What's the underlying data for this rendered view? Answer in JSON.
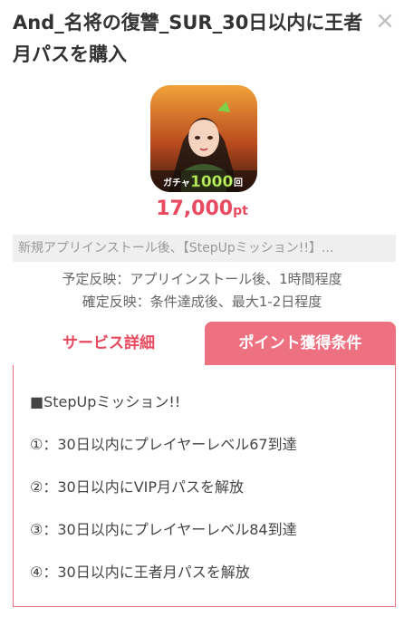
{
  "header": {
    "title": "And_名将の復讐_SUR_30日以内に王者月パスを購入",
    "close_label": "×"
  },
  "app_icon": {
    "name": "app-icon",
    "banner_text_a": "ガチャ",
    "banner_text_b": "1000",
    "banner_text_c": "回"
  },
  "reward": {
    "points": "17,000",
    "unit": "pt"
  },
  "summary": "新規アプリインストール後、【StepUpミッション!!】...",
  "schedule": {
    "line1": "予定反映：アプリインストール後、1時間程度",
    "line2": "確定反映：条件達成後、最大1-2日程度"
  },
  "tabs": {
    "service": "サービス詳細",
    "conditions": "ポイント獲得条件"
  },
  "conditions": {
    "heading": "■StepUpミッション!!",
    "steps": [
      "①：30日以内にプレイヤーレベル67到達",
      "②：30日以内にVIP月パスを解放",
      "③：30日以内にプレイヤーレベル84到達",
      "④：30日以内に王者月パスを解放"
    ]
  },
  "colors": {
    "accent": "#e84a5f",
    "tab_active_bg": "#ed7181",
    "summary_bg": "#efefef"
  }
}
